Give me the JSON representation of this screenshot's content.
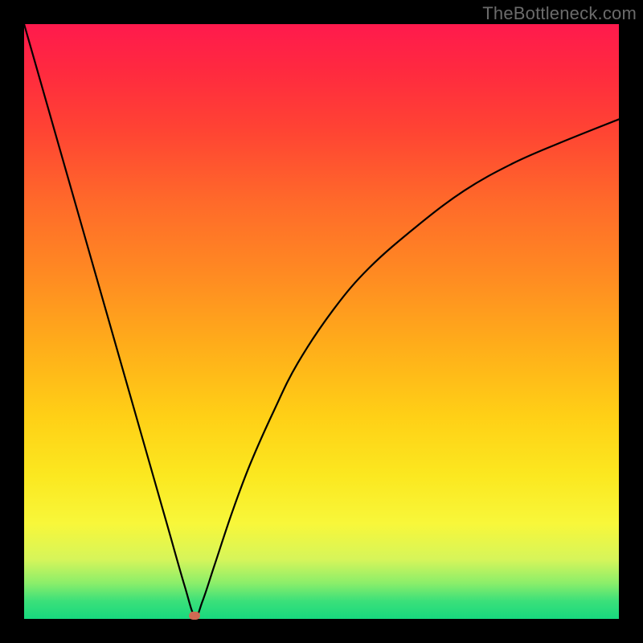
{
  "watermark": "TheBottleneck.com",
  "colors": {
    "page_bg": "#000000",
    "curve": "#000000",
    "marker": "#cf6a53",
    "gradient_top": "#ff1a4d",
    "gradient_bottom": "#17d97e"
  },
  "chart_data": {
    "type": "line",
    "title": "",
    "xlabel": "",
    "ylabel": "",
    "xlim": [
      0,
      100
    ],
    "ylim": [
      0,
      100
    ],
    "grid": false,
    "series": [
      {
        "name": "bottleneck-curve",
        "x": [
          0,
          4,
          8,
          12,
          16,
          20,
          24,
          27,
          28.7,
          30,
          32,
          35,
          38,
          42,
          46,
          52,
          58,
          66,
          74,
          82,
          90,
          100
        ],
        "y": [
          100,
          86,
          72,
          58,
          44,
          30,
          16,
          5.5,
          0.5,
          3,
          9,
          18,
          26,
          35,
          43,
          52,
          59,
          66,
          72,
          76.5,
          80,
          84
        ]
      }
    ],
    "markers": [
      {
        "name": "min-point",
        "x": 28.7,
        "y": 0.5
      }
    ],
    "notes": "Plot shows a V-shaped curve over a vertical red-to-green gradient. Values are estimated from pixel positions; no axis ticks or labels are rendered."
  },
  "layout": {
    "image_size": 800,
    "plot_margin": 30,
    "plot_size": 740
  }
}
